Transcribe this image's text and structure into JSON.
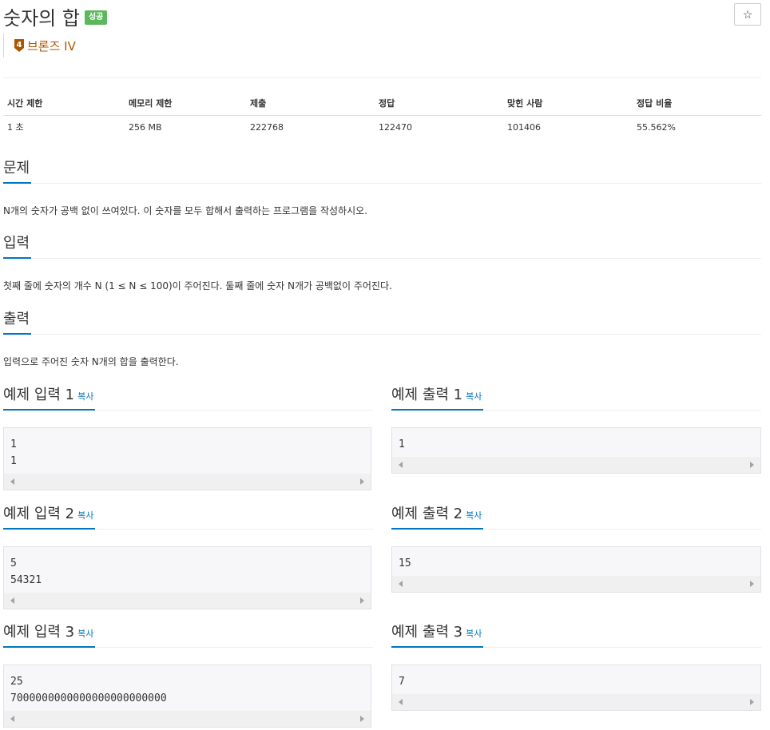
{
  "problem": {
    "title": "숫자의 합",
    "status_badge": "성공",
    "tier_number": "4",
    "tier_label": "브론즈 IV",
    "star_icon": "☆"
  },
  "colors": {
    "accent": "#0076c0",
    "success": "#5cb85c",
    "bronze": "#ad5600"
  },
  "info_table": {
    "headers": [
      "시간 제한",
      "메모리 제한",
      "제출",
      "정답",
      "맞힌 사람",
      "정답 비율"
    ],
    "row": [
      "1 초",
      "256 MB",
      "222768",
      "122470",
      "101406",
      "55.562%"
    ]
  },
  "sections": {
    "problem_label": "문제",
    "problem_text": "N개의 숫자가 공백 없이 쓰여있다. 이 숫자를 모두 합해서 출력하는 프로그램을 작성하시오.",
    "input_label": "입력",
    "input_text": "첫째 줄에 숫자의 개수 N (1 ≤ N ≤ 100)이 주어진다. 둘째 줄에 숫자 N개가 공백없이 주어진다.",
    "output_label": "출력",
    "output_text": "입력으로 주어진 숫자 N개의 합을 출력한다."
  },
  "copy_label": "복사",
  "samples": [
    {
      "input_title": "예제 입력 1",
      "input": "1\n1",
      "output_title": "예제 출력 1",
      "output": "1"
    },
    {
      "input_title": "예제 입력 2",
      "input": "5\n54321",
      "output_title": "예제 출력 2",
      "output": "15"
    },
    {
      "input_title": "예제 입력 3",
      "input": "25\n7000000000000000000000000",
      "output_title": "예제 출력 3",
      "output": "7"
    }
  ]
}
